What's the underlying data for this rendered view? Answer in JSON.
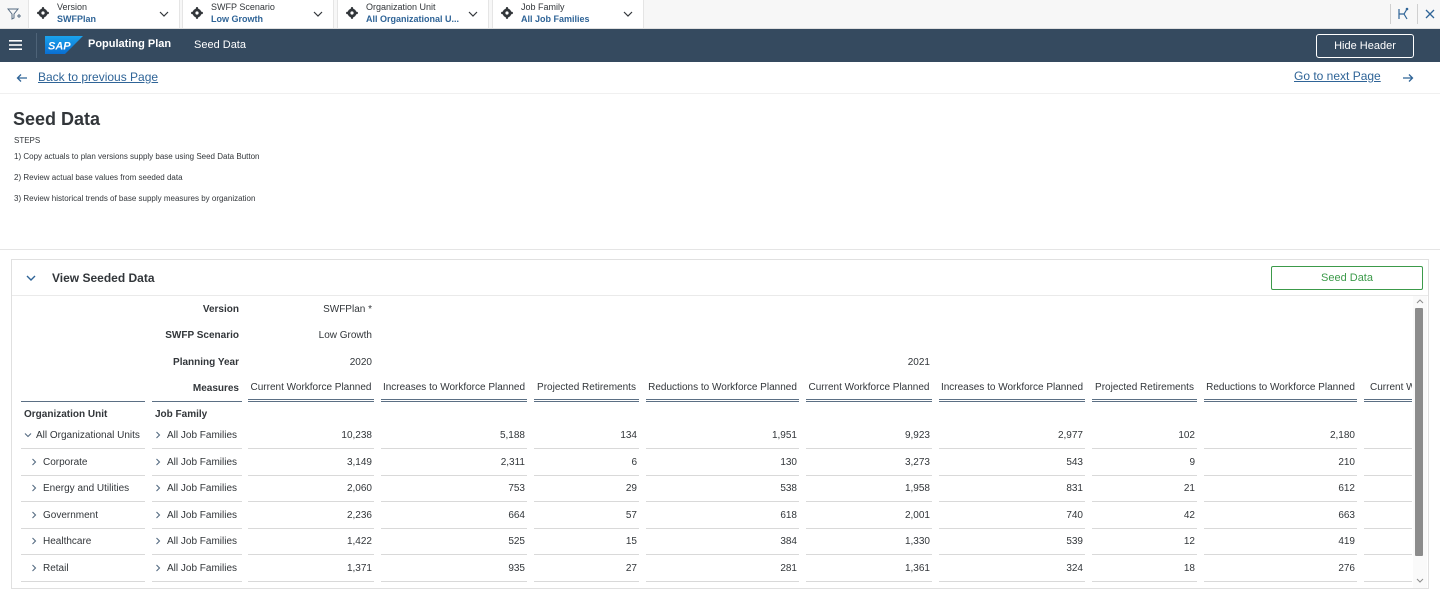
{
  "filters": [
    {
      "label": "Version",
      "value": "SWFPlan"
    },
    {
      "label": "SWFP Scenario",
      "value": "Low Growth"
    },
    {
      "label": "Organization Unit",
      "value": "All Organizational U..."
    },
    {
      "label": "Job Family",
      "value": "All Job Families"
    }
  ],
  "shell": {
    "title": "Populating Plan",
    "subtitle": "Seed Data",
    "hide_header": "Hide Header"
  },
  "nav": {
    "back": "Back to previous Page",
    "next": "Go to next Page"
  },
  "intro": {
    "title": "Seed Data",
    "steps_label": "STEPS",
    "steps": [
      "1) Copy actuals to plan versions supply base using Seed Data Button",
      "2) Review actual base values from seeded data",
      "3) Review historical trends of base supply measures by organization"
    ]
  },
  "panel": {
    "title": "View Seeded Data",
    "seed_button": "Seed Data"
  },
  "grid": {
    "labels": {
      "version": "Version",
      "scenario": "SWFP Scenario",
      "year": "Planning Year",
      "measures": "Measures",
      "org": "Organization Unit",
      "job": "Job Family"
    },
    "version_value": "SWFPlan *",
    "scenario_value": "Low Growth",
    "years": [
      "2020",
      "2021"
    ],
    "measures": [
      "Current Workforce Planned",
      "Increases to Workforce Planned",
      "Projected Retirements",
      "Reductions to Workforce Planned",
      "Current Workforce Planned",
      "Increases to Workforce Planned",
      "Projected Retirements",
      "Reductions to Workforce Planned",
      "Current W"
    ],
    "rows": [
      {
        "org": "All Organizational Units",
        "job": "All Job Families",
        "values": [
          "10,238",
          "5,188",
          "134",
          "1,951",
          "9,923",
          "2,977",
          "102",
          "2,180"
        ]
      },
      {
        "org": "Corporate",
        "job": "All Job Families",
        "values": [
          "3,149",
          "2,311",
          "6",
          "130",
          "3,273",
          "543",
          "9",
          "210"
        ]
      },
      {
        "org": "Energy and Utilities",
        "job": "All Job Families",
        "values": [
          "2,060",
          "753",
          "29",
          "538",
          "1,958",
          "831",
          "21",
          "612"
        ]
      },
      {
        "org": "Government",
        "job": "All Job Families",
        "values": [
          "2,236",
          "664",
          "57",
          "618",
          "2,001",
          "740",
          "42",
          "663"
        ]
      },
      {
        "org": "Healthcare",
        "job": "All Job Families",
        "values": [
          "1,422",
          "525",
          "15",
          "384",
          "1,330",
          "539",
          "12",
          "419"
        ]
      },
      {
        "org": "Retail",
        "job": "All Job Families",
        "values": [
          "1,371",
          "935",
          "27",
          "281",
          "1,361",
          "324",
          "18",
          "276"
        ]
      }
    ]
  },
  "icons": {
    "filter": "filter-add-icon",
    "dimension": "dimension-icon",
    "chevron": "chevron-down-icon",
    "back": "arrow-left-icon",
    "next": "arrow-right-icon"
  }
}
